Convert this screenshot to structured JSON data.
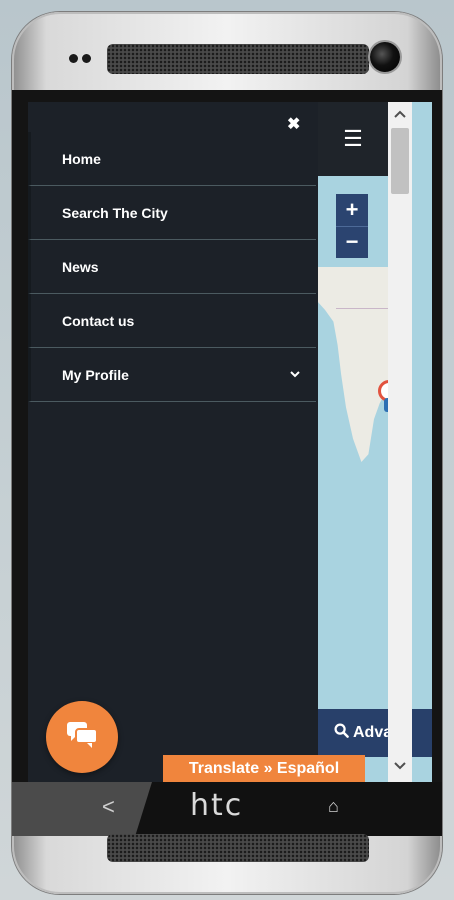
{
  "device": {
    "brand": "htc"
  },
  "drawer": {
    "close_icon": "close-icon",
    "items": [
      {
        "label": "Home"
      },
      {
        "label": "Search The City"
      },
      {
        "label": "News"
      },
      {
        "label": "Contact us"
      },
      {
        "label": "My Profile",
        "has_submenu": true
      }
    ]
  },
  "map": {
    "menu_icon": "hamburger-icon",
    "zoom_in_label": "+",
    "zoom_out_label": "−",
    "advanced_search_label": "Adva",
    "advanced_search_icon": "search-icon"
  },
  "chat_button": {
    "icon": "chat-bubbles-icon",
    "color": "#f0853d"
  },
  "translate_bar": {
    "label": "Translate » Español",
    "color": "#f0853d"
  },
  "nav_bar": {
    "back_icon": "back-icon",
    "home_icon": "home-icon"
  },
  "colors": {
    "drawer_bg": "#1c2128",
    "accent": "#f0853d",
    "map_control": "#2b4470"
  }
}
